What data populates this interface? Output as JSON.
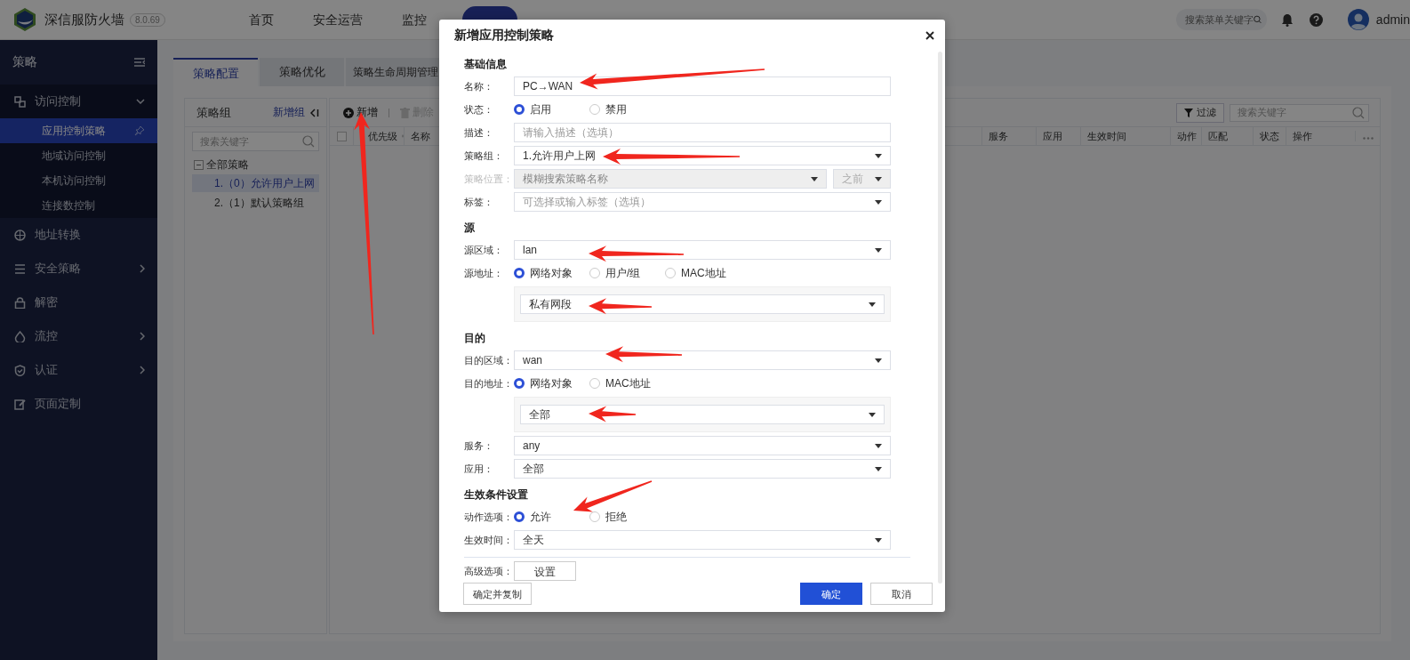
{
  "app": {
    "title": "深信服防火墙",
    "version": "8.0.69"
  },
  "top_nav": [
    {
      "label": "首页",
      "selected": false
    },
    {
      "label": "安全运营",
      "selected": false
    },
    {
      "label": "监控",
      "selected": false
    }
  ],
  "header": {
    "search_placeholder": "搜索菜单关键字",
    "user": "admin"
  },
  "sidebar": {
    "title": "策略",
    "items": [
      {
        "label": "访问控制",
        "expanded": true,
        "children": [
          {
            "label": "应用控制策略",
            "selected": true
          },
          {
            "label": "地域访问控制",
            "selected": false
          },
          {
            "label": "本机访问控制",
            "selected": false
          },
          {
            "label": "连接数控制",
            "selected": false
          }
        ]
      },
      {
        "label": "地址转换"
      },
      {
        "label": "安全策略",
        "expanded": false
      },
      {
        "label": "解密"
      },
      {
        "label": "流控",
        "expanded": false
      },
      {
        "label": "认证",
        "expanded": false
      },
      {
        "label": "页面定制"
      }
    ]
  },
  "tabs": [
    {
      "label": "策略配置",
      "selected": true
    },
    {
      "label": "策略优化",
      "selected": false
    },
    {
      "label": "策略生命周期管理",
      "selected": false
    }
  ],
  "group_panel": {
    "title": "策略组",
    "add_link": "新增组",
    "search_placeholder": "搜索关键字",
    "tree": {
      "label": "全部策略",
      "expanded": true,
      "children": [
        {
          "label": "1.（0）允许用户上网",
          "selected": true
        },
        {
          "label": "2.（1）默认策略组",
          "selected": false
        }
      ]
    }
  },
  "toolbar": [
    {
      "label": "新增",
      "disabled": false
    },
    {
      "label": "删除",
      "disabled": true
    }
  ],
  "filter": {
    "button": "过滤",
    "search_placeholder": "搜索关键字"
  },
  "table": {
    "select_all_checked": false,
    "columns": [
      "优先级",
      "名称",
      "服务",
      "应用",
      "生效时间",
      "动作",
      "匹配",
      "状态",
      "操作"
    ]
  },
  "dialog": {
    "title": "新增应用控制策略",
    "sections": [
      {
        "title": "基础信息",
        "fields": [
          {
            "kind": "input",
            "label": "名称：",
            "value": "PC→WAN"
          },
          {
            "kind": "radio",
            "label": "状态：",
            "options": [
              {
                "label": "启用",
                "selected": true
              },
              {
                "label": "禁用",
                "selected": false
              }
            ]
          },
          {
            "kind": "input",
            "label": "描述：",
            "placeholder": "请输入描述（选填）"
          },
          {
            "kind": "select",
            "label": "策略组：",
            "value": "1.允许用户上网",
            "disabled": false
          },
          {
            "kind": "select_pair",
            "label": "策略位置：",
            "placeholder": "模糊搜索策略名称",
            "disabled": true,
            "second": "之前"
          },
          {
            "kind": "select",
            "label": "标签：",
            "placeholder": "可选择或输入标签（选填）",
            "disabled": false
          }
        ]
      },
      {
        "title": "源",
        "fields": [
          {
            "kind": "select",
            "label": "源区域：",
            "value": "lan",
            "disabled": false
          },
          {
            "kind": "radio",
            "label": "源地址：",
            "options": [
              {
                "label": "网络对象",
                "selected": true
              },
              {
                "label": "用户/组",
                "selected": false
              },
              {
                "label": "MAC地址",
                "selected": false
              }
            ]
          },
          {
            "kind": "subselect",
            "value": "私有网段"
          }
        ]
      },
      {
        "title": "目的",
        "fields": [
          {
            "kind": "select",
            "label": "目的区域：",
            "value": "wan",
            "disabled": false
          },
          {
            "kind": "radio",
            "label": "目的地址：",
            "options": [
              {
                "label": "网络对象",
                "selected": true
              },
              {
                "label": "MAC地址",
                "selected": false
              }
            ]
          },
          {
            "kind": "subselect",
            "value": "全部"
          },
          {
            "kind": "select",
            "label": "服务：",
            "value": "any",
            "disabled": false
          },
          {
            "kind": "select",
            "label": "应用：",
            "value": "全部",
            "disabled": false
          }
        ]
      },
      {
        "title": "生效条件设置",
        "fields": [
          {
            "kind": "radio",
            "label": "动作选项：",
            "options": [
              {
                "label": "允许",
                "selected": true
              },
              {
                "label": "拒绝",
                "selected": false
              }
            ]
          },
          {
            "kind": "select",
            "label": "生效时间：",
            "value": "全天",
            "disabled": false
          },
          {
            "kind": "button",
            "label": "高级选项：",
            "button": "设置"
          }
        ]
      }
    ],
    "footer": [
      {
        "label": "确定并复制",
        "kind": "secondary"
      },
      {
        "label": "确定",
        "kind": "primary"
      },
      {
        "label": "取消",
        "kind": "secondary"
      }
    ]
  }
}
